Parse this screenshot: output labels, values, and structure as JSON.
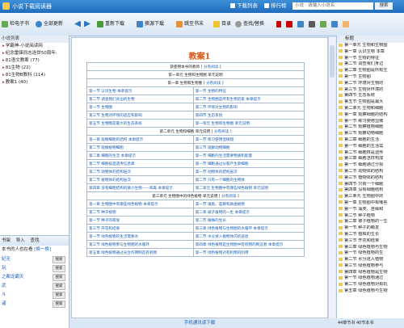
{
  "window": {
    "title": "小说下载阅读器"
  },
  "titlebar": {
    "download_list": "下载列表",
    "ranking": "排行榜",
    "search_placeholder": "小说 · 请输入小说名",
    "search_button": "搜索"
  },
  "toolbar": {
    "left_buttons": [
      "检电子书",
      "全部更新"
    ],
    "buttons": [
      "重新下载",
      "换源下载",
      "跳至书末",
      "目录",
      "查找/替换"
    ]
  },
  "left_tree": {
    "header": "小说列表",
    "items": [
      "学霸神-小说阅读网",
      "纪念雷锋同志逝世50周年:",
      "81语文教案 (77)",
      "81生物 (22)",
      "81生物B教科 (114)",
      "教案1 (40)"
    ]
  },
  "left_bottom": {
    "tabs": [
      "书架",
      "导入",
      "查找"
    ],
    "recommend_title": "本书的人也在看",
    "change_label": "[换一换]",
    "items": [
      {
        "name": "妃无",
        "button": "搜索"
      },
      {
        "name": "玩",
        "button": "搜索"
      },
      {
        "name": "之都龙霸天",
        "button": "搜索"
      },
      {
        "name": "武",
        "button": "搜索"
      },
      {
        "name": "斗",
        "button": "搜索"
      },
      {
        "name": "诸",
        "button": "搜索"
      }
    ]
  },
  "document": {
    "title": "教案1",
    "rows": [
      {
        "type": "header",
        "text": "获使用本书的教师",
        "link": "分卷阅读"
      },
      {
        "type": "full",
        "text": "第一单元  生物和生物圈  单元说明"
      },
      {
        "type": "header",
        "text": "第一章  生物和生物圈",
        "link": "分卷阅读"
      },
      {
        "type": "pair",
        "left": "第一节  认识生物  本章提示",
        "right": "第一节  生物的特征"
      },
      {
        "type": "pair",
        "left": "第二节  调查我们身边的生物",
        "right": "第二节  生物圈是所有生物的家  本章提示"
      },
      {
        "type": "pair",
        "left": "第一节  生物圈",
        "right": "第二节  环境对生物的影响"
      },
      {
        "type": "pair",
        "left": "第三节  生物对环境的适应和影响",
        "right": "第四节  生态系统"
      },
      {
        "type": "pair",
        "left": "第五节  生物圈是最大的生态系统",
        "right": "第一单元  生物和生物圈  单元说明"
      },
      {
        "type": "header",
        "text": "第二单元  生物和细胞  单元说明",
        "link": "分卷阅读"
      },
      {
        "type": "pair",
        "left": "第一章  观察细胞的结构  本章提示",
        "right": "第一节  练习使用显微镜"
      },
      {
        "type": "pair",
        "left": "第二节  观察植物细胞",
        "right": "第三节  观察动物细胞"
      },
      {
        "type": "pair",
        "left": "第二章  细胞的生活  本章提示",
        "right": "第一节  细胞的生活需要物质和能量"
      },
      {
        "type": "pair",
        "left": "第二节  细胞核是遗传信息库",
        "right": "第一节  细胞通过分裂产生新细胞"
      },
      {
        "type": "pair",
        "left": "第二节  动物体的结构层次",
        "right": "第一节  动物体的结构层次"
      },
      {
        "type": "pair",
        "left": "第二节  植物体的结构层次",
        "right": "第二节  只有一个细胞的生物体"
      },
      {
        "type": "pair",
        "left": "第四章  没有细胞结构的微小生物——病毒  本章提示",
        "right": "第二单元  生物圈中有哪些绿色植物  单元说明"
      },
      {
        "type": "header",
        "text": "第三单元  生物圈中的绿色植物  单元说明",
        "link": "分卷阅读"
      },
      {
        "type": "pair",
        "left": "第一章  生物圈中有哪些绿色植物  本章提示",
        "right": "第一节  藻类、苔藓和蕨类植物"
      },
      {
        "type": "pair",
        "left": "第二节  种子植物",
        "right": "第二章  被子植物的一生  本章提示"
      },
      {
        "type": "pair",
        "left": "第一节  种子的萌发",
        "right": "第二节  植株的生长"
      },
      {
        "type": "pair",
        "left": "第三节  开花和结果",
        "right": "第三章  绿色植物与生物圈的水循环  本章提示"
      },
      {
        "type": "pair",
        "left": "第一节  绿色植物的生活需要水",
        "right": "第二节  水分进入植物体内的途径"
      },
      {
        "type": "pair",
        "left": "第三节  绿色植物参与生物圈的水循环",
        "right": "第四章  绿色植物是生物圈中有机物的制造者  本章提示"
      },
      {
        "type": "pair",
        "left": "第五章  绿色植物通过光合作用制造有机物",
        "right": "第一节  绿色植物对有机物的利用"
      }
    ]
  },
  "right_pane": {
    "header": "标题",
    "items": [
      "第一单元 生物和生物圈",
      "第一章 认识生物 本章",
      "第一节 生物的特征",
      "第二节 调查我们身边",
      "第二章 生物圈是所有生",
      "第一节 生物圈",
      "第二节 环境对生物的",
      "第三节 生物对环境的",
      "第四节 生态系统",
      "第五节 生物圈是最大",
      "第二单元 生物和细胞",
      "第一章 观察细胞的结构",
      "第一节 练习使用显微",
      "第二节 观察植物细胞",
      "第三节 观察动物细胞",
      "第二章 细胞的生活",
      "第一节 细胞的生活需",
      "第二节 细胞核是遗传",
      "第三章 细胞怎样构成",
      "第一节 细胞通过分裂",
      "第二节 动物体的结构",
      "第三节 植物体的结构",
      "第四节 只有一个细胞",
      "第四章 没有细胞结构",
      "第三单元 生物圈中的",
      "第一章 生物圈中有哪些",
      "第一节 藻类、苔藓和",
      "第二节 种子植物",
      "第二章 被子植物的一生",
      "第一节 种子的萌发",
      "第二节 植株的生长",
      "第三节 开花和结果",
      "第三章 绿色植物与生物",
      "第一节 绿色植物的生",
      "第二节 水分进入植物",
      "第三节 绿色植物参与",
      "第四章 绿色植物是生物",
      "第一节 绿色植物通过",
      "第二节 绿色植物对有机",
      "第五章 绿色植物与生物"
    ]
  },
  "footer": {
    "center": "手机通讯读下载",
    "status": "44章节书 40节本书"
  }
}
